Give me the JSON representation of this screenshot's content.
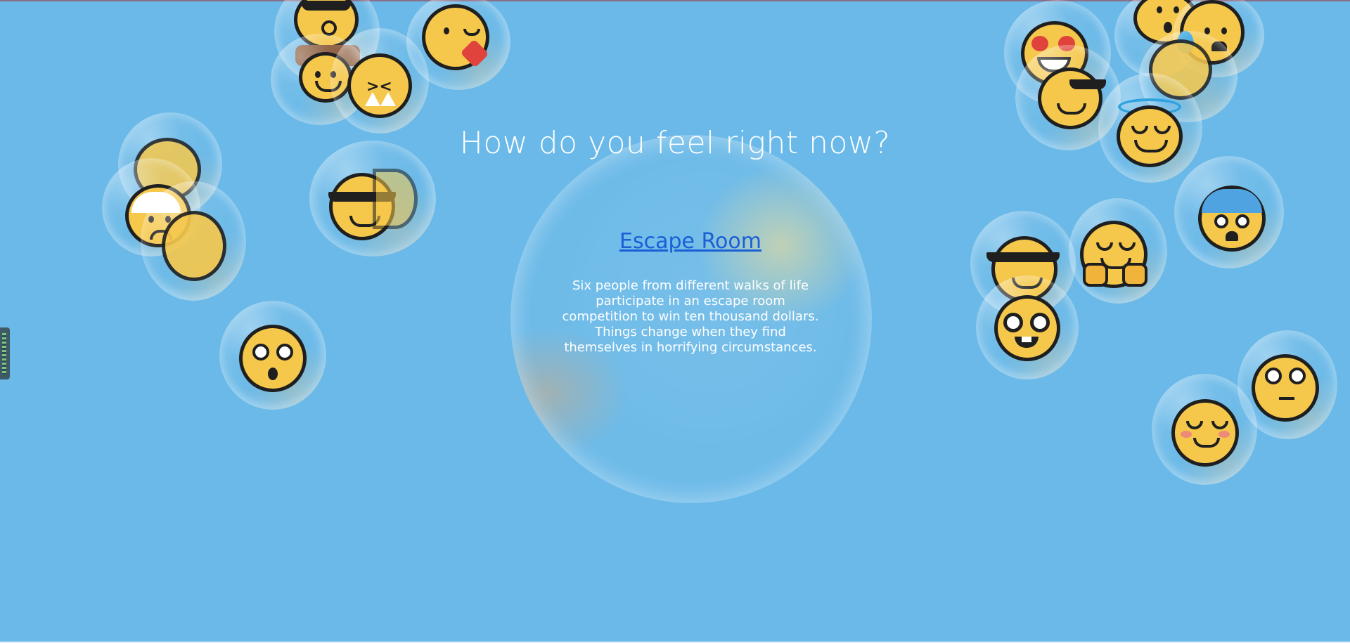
{
  "page": {
    "question": "How do you feel right now?"
  },
  "card": {
    "title": "Escape Room",
    "description": "Six people from different walks of life participate in an escape room competition to win ten thousand dollars. Things change when they find themselves in horrifying circumstances."
  },
  "colors": {
    "background": "#6ab9e8",
    "emoji_face": "#f5c84c",
    "link": "#1a5fd6"
  },
  "emojis": [
    "surprised-face-icon",
    "winking-kiss-face-icon",
    "smiling-face-icon",
    "squinting-face-icon",
    "neutral-face-icon",
    "bandaged-face-icon",
    "sunglasses-face-icon",
    "astonished-face-icon",
    "heart-eyes-face-icon",
    "surprised-face-icon",
    "anxious-sweat-face-icon",
    "sunglasses-face-icon",
    "halo-face-icon",
    "sunglasses-face-icon",
    "hugging-face-icon",
    "fearful-face-icon",
    "nerd-face-icon",
    "rolling-eyes-face-icon",
    "blushing-face-icon"
  ]
}
